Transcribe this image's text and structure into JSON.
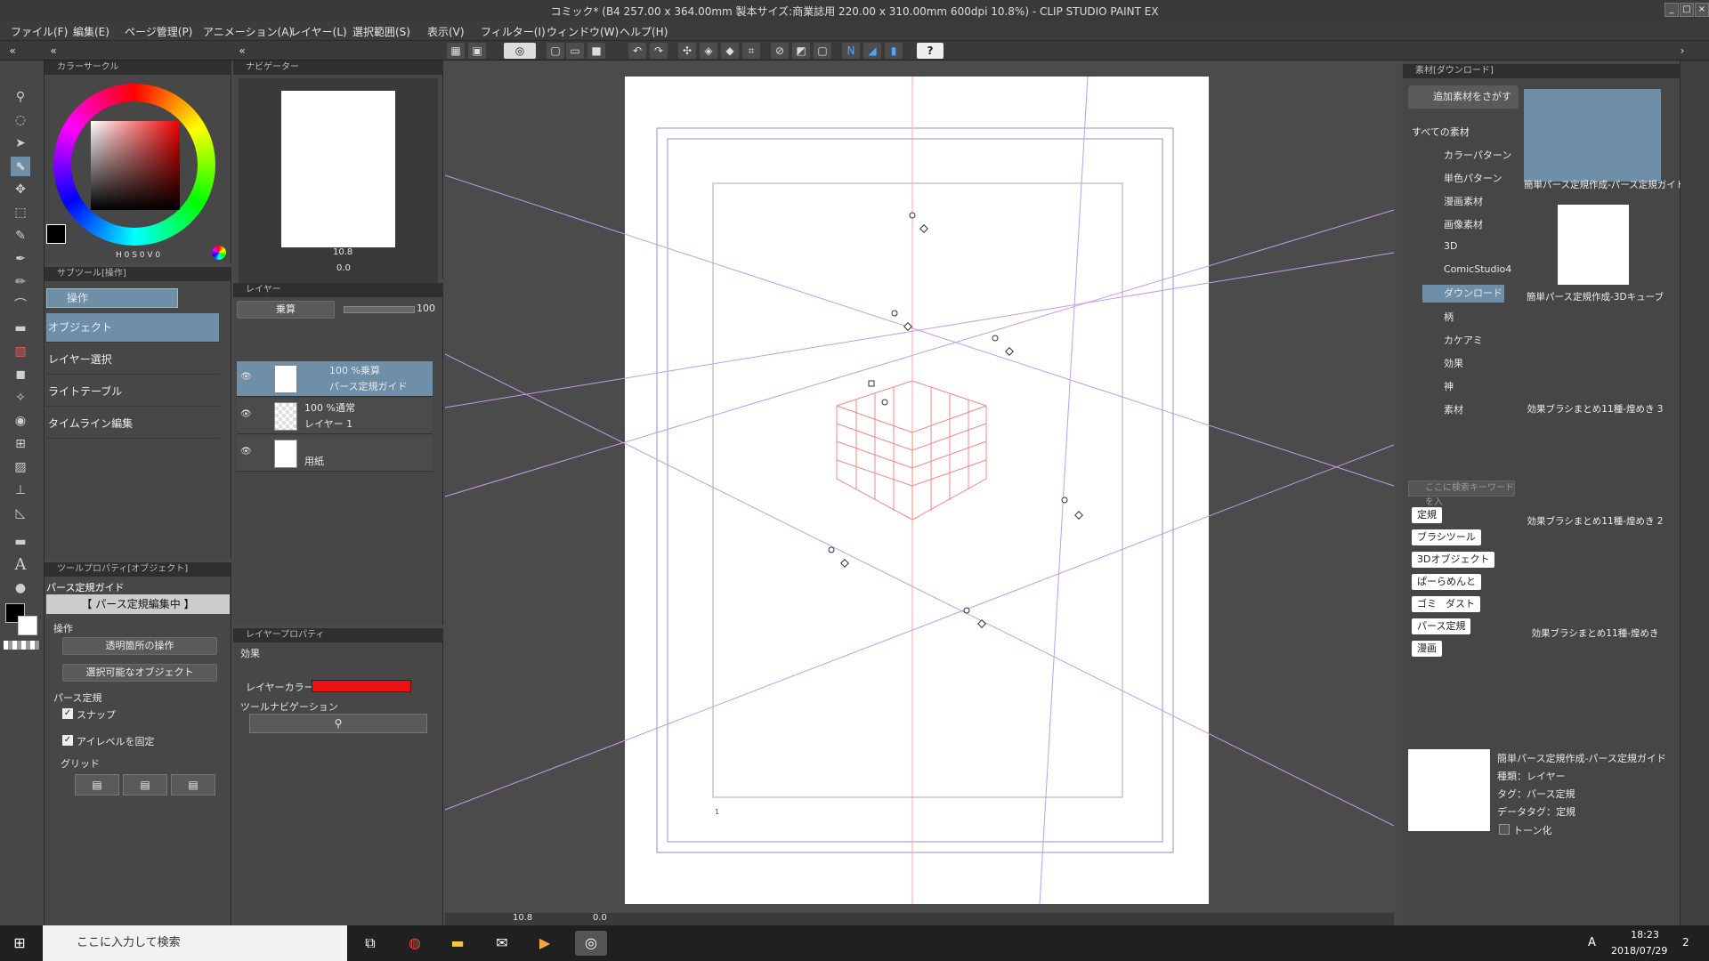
{
  "window": {
    "title": "コミック* (B4 257.00 x 364.00mm 製本サイズ:商業誌用 220.00 x 310.00mm 600dpi 10.8%) - CLIP STUDIO PAINT EX"
  },
  "menu": [
    "ファイル(F)",
    "編集(E)",
    "ページ管理(P)",
    "アニメーション(A)",
    "レイヤー(L)",
    "選択範囲(S)",
    "表示(V)",
    "フィルター(I)",
    "ウィンドウ(W)",
    "ヘルプ(H)"
  ],
  "color_panel": {
    "tab": "カラーサークル",
    "values": "H 0 S 0 V 0",
    "main_color": "#000000",
    "sub_color": "#ffffff"
  },
  "navigator": {
    "tab": "ナビゲーター",
    "zoom": "10.8",
    "angle": "0.0"
  },
  "subtool": {
    "tab": "サブツール[操作]",
    "group": "操作",
    "items": [
      "オブジェクト",
      "レイヤー選択",
      "ライトテーブル",
      "タイムライン編集"
    ]
  },
  "tool_property": {
    "tab": "ツールプロパティ[オブジェクト]",
    "target": "パース定規ガイド",
    "mode_banner": "【 パース定規編集中 】",
    "operation_label": "操作",
    "transparent_op": "透明箇所の操作",
    "selectable_obj": "選択可能なオブジェクト",
    "perspective_label": "パース定規",
    "snap": "スナップ",
    "eye_level": "アイレベルを固定",
    "grid": "グリッド"
  },
  "layer_panel": {
    "tab": "レイヤー",
    "blend": "乗算",
    "opacity": "100",
    "layers": [
      {
        "mode": "100 %乗算",
        "name": "パース定規ガイド"
      },
      {
        "mode": "100 %通常",
        "name": "レイヤー 1"
      },
      {
        "mode": "",
        "name": "用紙"
      }
    ]
  },
  "layer_property": {
    "tab": "レイヤープロパティ",
    "effect": "効果",
    "layer_color_label": "レイヤーカラー",
    "layer_color": "#ee1111",
    "tool_nav": "ツールナビゲーション"
  },
  "canvas": {
    "zoom": "10.8",
    "angle": "0.0",
    "page_number": "1"
  },
  "material_panel": {
    "tab": "素材[ダウンロード]",
    "search_more": "追加素材をさがす",
    "tree": [
      "すべての素材",
      "カラーパターン",
      "単色パターン",
      "漫画素材",
      "画像素材",
      "3D",
      "ComicStudio4",
      "ダウンロード",
      "柄",
      "カケアミ",
      "効果",
      "神",
      "素材"
    ],
    "search_placeholder": "ここに検索キーワードを入",
    "tags": [
      "定規",
      "ブラシツール",
      "3Dオブジェクト",
      "ぱーらめんと",
      "ゴミ",
      "ダスト",
      "パース定規",
      "漫画"
    ],
    "items": [
      "簡単パース定規作成-パース定規ガイド",
      "簡単パース定規作成-3Dキューブ",
      "効果ブラシまとめ11種-煌めき 3",
      "効果ブラシまとめ11種-煌めき 2",
      "効果ブラシまとめ11種-煌めき"
    ],
    "detail": {
      "name": "簡単パース定規作成-パース定規ガイド",
      "type": "種類：レイヤー",
      "tag": "タグ：パース定規",
      "datatag": "データタグ：定規",
      "tone": "トーン化"
    }
  },
  "taskbar": {
    "search_placeholder": "ここに入力して検索",
    "time": "18:23",
    "date": "2018/07/29",
    "notif": "2",
    "ime": "A"
  }
}
